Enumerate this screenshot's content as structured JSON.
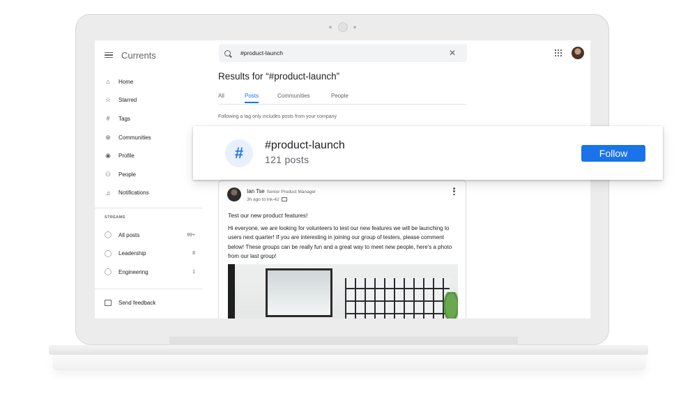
{
  "app": {
    "title": "Currents"
  },
  "sidebar": {
    "items": [
      {
        "label": "Home",
        "icon": "home-icon"
      },
      {
        "label": "Starred",
        "icon": "star-icon"
      },
      {
        "label": "Tags",
        "icon": "hash-icon"
      },
      {
        "label": "Communities",
        "icon": "communities-icon"
      },
      {
        "label": "Profile",
        "icon": "profile-icon"
      },
      {
        "label": "People",
        "icon": "people-icon"
      },
      {
        "label": "Notifications",
        "icon": "bell-icon"
      }
    ],
    "streams_label": "STREAMS",
    "streams": [
      {
        "label": "All posts",
        "count": "99+"
      },
      {
        "label": "Leadership",
        "count": "8"
      },
      {
        "label": "Engineering",
        "count": "1"
      }
    ],
    "feedback_label": "Send feedback"
  },
  "search": {
    "value": "#product-launch"
  },
  "results": {
    "title": "Results for “#product-launch”",
    "tabs": [
      {
        "label": "All",
        "active": false
      },
      {
        "label": "Posts",
        "active": true
      },
      {
        "label": "Communities",
        "active": false
      },
      {
        "label": "People",
        "active": false
      }
    ],
    "notice": "Following a tag only includes posts from your company"
  },
  "tag_card": {
    "name": "#product-launch",
    "count": "121 posts",
    "follow_label": "Follow",
    "icon_glyph": "#"
  },
  "post": {
    "author": "Ian Tse",
    "role": "Senior Product Manager",
    "meta": "3h ago to lnk-42",
    "title": "Test our new product features!",
    "body": "Hi everyone, we are looking for volunteers to test our new features we will be launching to users next quarter! If you are interesting in joining our group of testers, please comment below! These groups can be really fun and a great way to meet new people, here's a photo from our last group!"
  },
  "colors": {
    "accent": "#1a73e8",
    "text": "#202124",
    "muted": "#5f6368"
  }
}
